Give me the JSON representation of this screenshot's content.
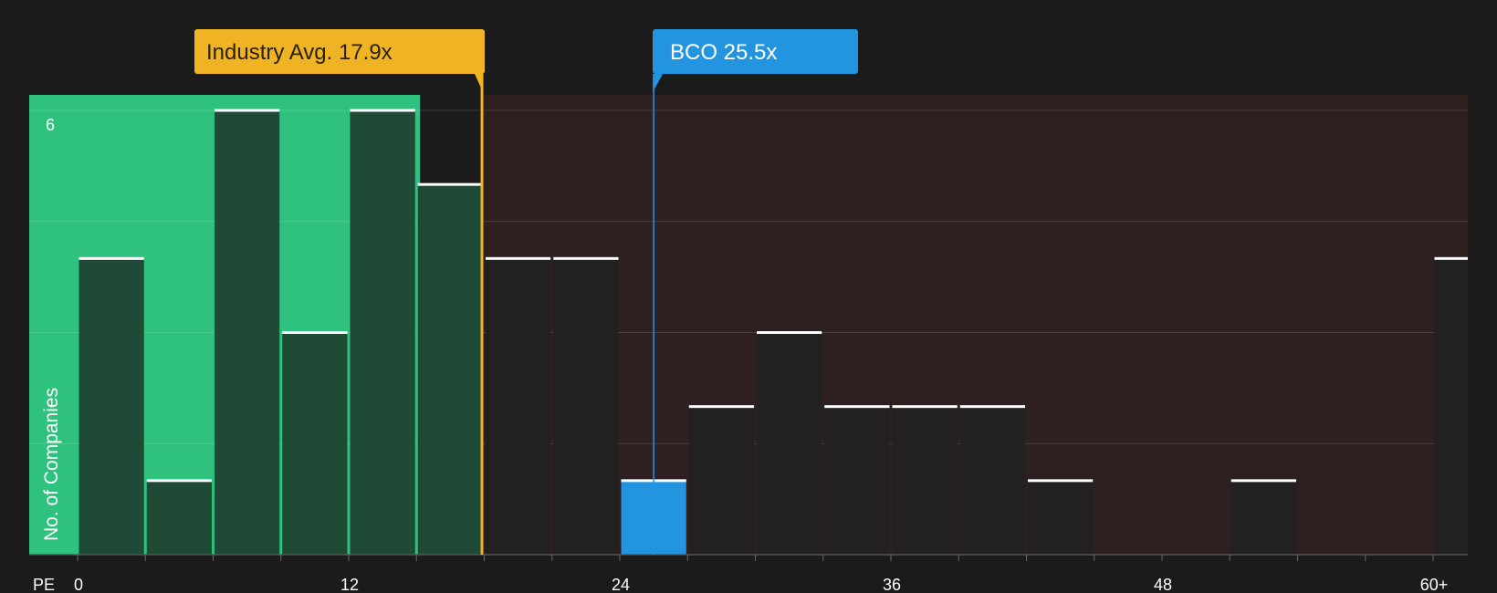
{
  "chart_data": {
    "type": "bar",
    "x_axis_label": "PE",
    "y_axis_label": "No. of Companies",
    "x_ticks": [
      "0",
      "12",
      "24",
      "36",
      "48",
      "60+"
    ],
    "y_tick_labels": [
      {
        "value": 6,
        "label": "6"
      }
    ],
    "ylim": [
      0,
      6
    ],
    "bin_width": 3,
    "bins": [
      {
        "start": 0,
        "count": 4
      },
      {
        "start": 3,
        "count": 1
      },
      {
        "start": 6,
        "count": 6
      },
      {
        "start": 9,
        "count": 3
      },
      {
        "start": 12,
        "count": 6
      },
      {
        "start": 15,
        "count": 5
      },
      {
        "start": 18,
        "count": 4
      },
      {
        "start": 21,
        "count": 4
      },
      {
        "start": 24,
        "count": 1
      },
      {
        "start": 27,
        "count": 2
      },
      {
        "start": 30,
        "count": 3
      },
      {
        "start": 33,
        "count": 2
      },
      {
        "start": 36,
        "count": 2
      },
      {
        "start": 39,
        "count": 2
      },
      {
        "start": 42,
        "count": 1
      },
      {
        "start": 45,
        "count": 0
      },
      {
        "start": 48,
        "count": 0
      },
      {
        "start": 51,
        "count": 1
      },
      {
        "start": 54,
        "count": 0
      },
      {
        "start": 57,
        "count": 0
      },
      {
        "start": 60,
        "count": 4
      }
    ],
    "industry_avg": {
      "value": 17.9,
      "label": "Industry Avg. 17.9x"
    },
    "company": {
      "ticker": "BCO",
      "value": 25.5,
      "label": "BCO 25.5x"
    },
    "colors": {
      "background": "#1b1b1b",
      "below_avg_region": "#2ec27e",
      "above_avg_region": "#2e1f20",
      "industry_avg": "#f0b323",
      "company": "#2394e0",
      "bar_green": "#1f4a36",
      "bar_dark": "#222020",
      "bar_top": "#ffffff"
    }
  }
}
